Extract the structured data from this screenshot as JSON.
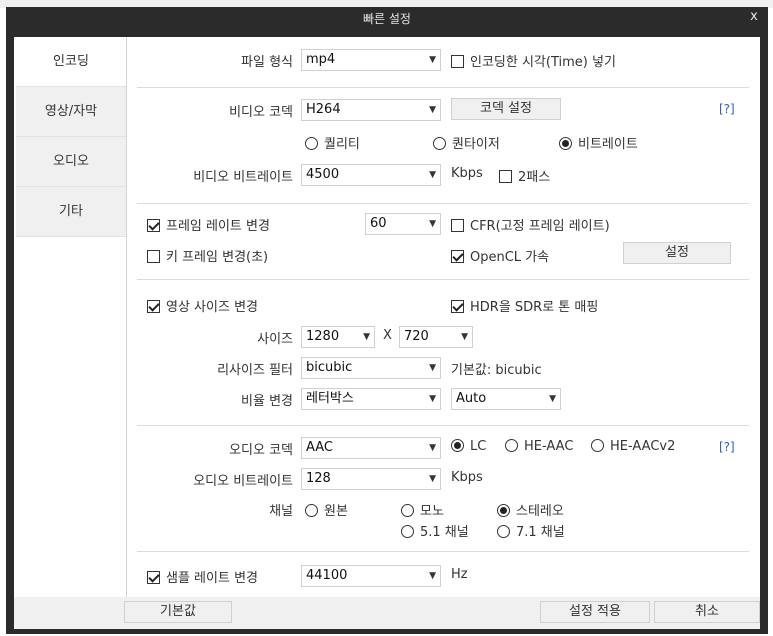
{
  "window": {
    "title": "빠른 설정",
    "close_glyph": "x"
  },
  "sidebar": {
    "items": [
      {
        "label": "인코딩"
      },
      {
        "label": "영상/자막"
      },
      {
        "label": "오디오"
      },
      {
        "label": "기타"
      }
    ]
  },
  "encoding": {
    "file_format_label": "파일 형식",
    "file_format_value": "mp4",
    "insert_time_label": "인코딩한 시각(Time) 넣기",
    "insert_time_checked": false
  },
  "video": {
    "codec_label": "비디오 코덱",
    "codec_value": "H264",
    "codec_settings_button": "코덱 설정",
    "help_link": "[?]",
    "rate_modes": [
      {
        "label": "퀄리티",
        "checked": false
      },
      {
        "label": "퀀타이저",
        "checked": false
      },
      {
        "label": "비트레이트",
        "checked": true
      }
    ],
    "bitrate_label": "비디오 비트레이트",
    "bitrate_value": "4500",
    "bitrate_unit": "Kbps",
    "two_pass_label": "2패스",
    "two_pass_checked": false
  },
  "frame": {
    "change_fps_label": "프레임 레이트 변경",
    "change_fps_checked": true,
    "fps_value": "60",
    "cfr_label": "CFR(고정 프레임 레이트)",
    "cfr_checked": false,
    "keyframe_label": "키 프레임 변경(초)",
    "keyframe_checked": false,
    "opencl_label": "OpenCL 가속",
    "opencl_checked": true,
    "opencl_settings_button": "설정"
  },
  "resize": {
    "change_size_label": "영상 사이즈 변경",
    "change_size_checked": true,
    "hdr_label": "HDR을 SDR로 톤 매핑",
    "hdr_checked": true,
    "size_label": "사이즈",
    "width_value": "1280",
    "x_label": "X",
    "height_value": "720",
    "filter_label": "리사이즈 필터",
    "filter_value": "bicubic",
    "filter_default_note": "기본값: bicubic",
    "ratio_label": "비율 변경",
    "ratio_value": "레터박스",
    "ratio_mode_value": "Auto"
  },
  "audio": {
    "codec_label": "오디오 코덱",
    "codec_value": "AAC",
    "profiles": [
      {
        "label": "LC",
        "checked": true
      },
      {
        "label": "HE-AAC",
        "checked": false
      },
      {
        "label": "HE-AACv2",
        "checked": false
      }
    ],
    "help_link": "[?]",
    "bitrate_label": "오디오 비트레이트",
    "bitrate_value": "128",
    "bitrate_unit": "Kbps",
    "channel_label": "채널",
    "channels": [
      {
        "label": "원본",
        "checked": false
      },
      {
        "label": "모노",
        "checked": false
      },
      {
        "label": "스테레오",
        "checked": true
      },
      {
        "label": "5.1 채널",
        "checked": false
      },
      {
        "label": "7.1 채널",
        "checked": false
      }
    ],
    "sample_rate_label": "샘플 레이트 변경",
    "sample_rate_checked": true,
    "sample_rate_value": "44100",
    "sample_rate_unit": "Hz"
  },
  "footer": {
    "default_button": "기본값",
    "apply_button": "설정 적용",
    "cancel_button": "취소"
  }
}
